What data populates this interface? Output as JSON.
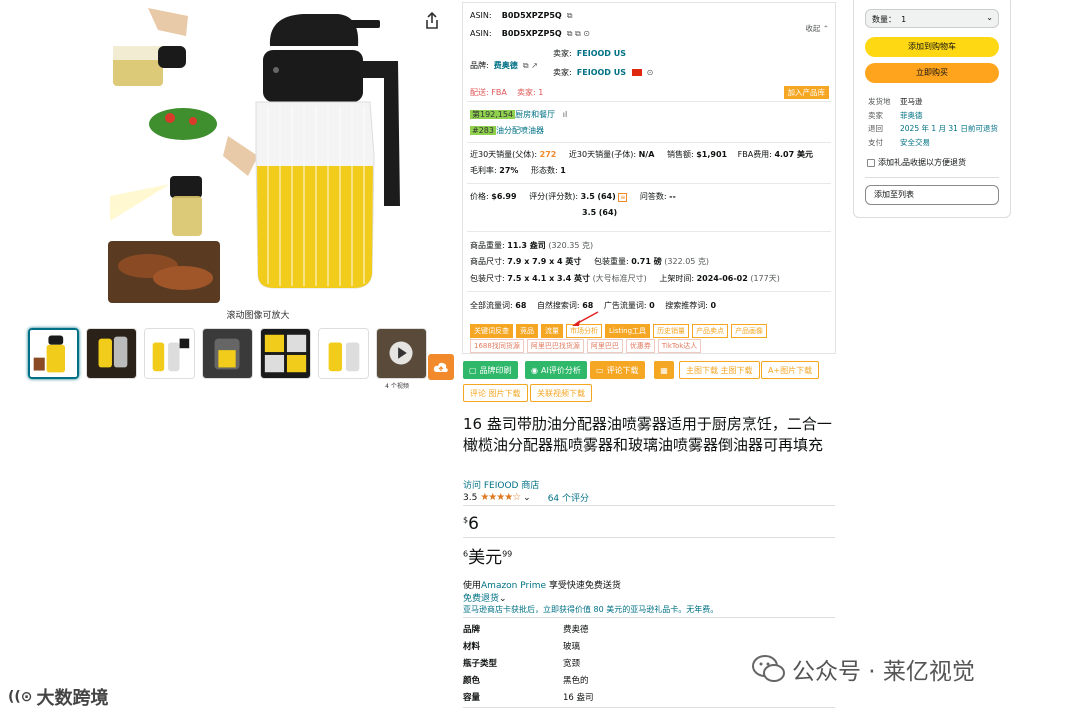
{
  "gallery": {
    "zoom_hint": "滚动图像可放大",
    "video_count": "4 个视频",
    "icons": [
      "share-icon",
      "upload-cloud-icon",
      "play-icon"
    ]
  },
  "plugin": {
    "asin_label_1": "ASIN:",
    "asin_value_1": "B0D5XPZP5Q",
    "collapse": "收起 ⌃",
    "asin_label_2": "ASIN:",
    "asin_value_2": "B0D5XPZP5Q",
    "brand_label": "品牌:",
    "brand_value": "费奥德",
    "seller_label_1": "卖家:",
    "seller_value_1": "FEIOOD US",
    "seller_label_2": "卖家:",
    "seller_value_2": "FEIOOD US",
    "fulfill": "配送: FBA",
    "sellers_count": "卖家: 1",
    "add_library": "加入产品库",
    "rank1_num": "第192,154",
    "rank1_cat": "厨房和餐厅",
    "rank2_num": "#283",
    "rank2_cat": "油分配喷油器",
    "sales_parent_label": "近30天销量(父体):",
    "sales_parent_value": "272",
    "sales_child_label": "近30天销量(子体):",
    "sales_child_value": "N/A",
    "revenue_label": "销售额:",
    "revenue_value": "$1,901",
    "fba_label": "FBA费用:",
    "fba_value": "4.07 美元",
    "margin_label": "毛利率:",
    "margin_value": "27%",
    "variants_label": "形态数:",
    "variants_value": "1",
    "price_label": "价格:",
    "price_value": "$6.99",
    "rating_label": "评分(评分数):",
    "rating_value_1": "3.5",
    "rating_count_1": "(64)",
    "rating_value_2": "3.5",
    "rating_count_2": "(64)",
    "qa_label": "问答数:",
    "qa_value": "--",
    "weight_label": "商品重量:",
    "weight_value": "11.3 盎司",
    "weight_alt": "(320.35 克)",
    "size_label": "商品尺寸:",
    "size_value": "7.9 x 7.9 x 4 英寸",
    "pkg_weight_label": "包装重量:",
    "pkg_weight_value": "0.71 磅",
    "pkg_weight_alt": "(322.05 克)",
    "pkg_size_label": "包装尺寸:",
    "pkg_size_value": "7.5 x 4.1 x 3.4 英寸",
    "pkg_size_alt": "(大号标准尺寸)",
    "listed_label": "上架时间:",
    "listed_value": "2024-06-02",
    "listed_alt": "(177天)",
    "traffic_all_label": "全部流量词:",
    "traffic_all_value": "68",
    "traffic_natural_label": "自然搜索词:",
    "traffic_natural_value": "68",
    "traffic_ad_label": "广告流量词:",
    "traffic_ad_value": "0",
    "traffic_rec_label": "搜索推荐词:",
    "traffic_rec_value": "0",
    "chips_row1": [
      "关键词反查",
      "竞品",
      "流量",
      "市场分析",
      "Listing工具",
      "历史销量",
      "产品卖点",
      "产品画像"
    ],
    "chips_row2": [
      "1688找同货源",
      "阿里巴巴找货源",
      "阿里巴巴",
      "优惠券",
      "TikTok达人"
    ]
  },
  "toolbar": {
    "brand_record": "品牌印刷",
    "ai_review": "AI评价分析",
    "review_download": "评论下载",
    "main_img_download": "主图下载 主图下载",
    "aplus_download": "A+图片下载",
    "review_img_download": "评论 图片下载",
    "related_video_download": "关联视频下载"
  },
  "product": {
    "title": "16 盎司带肋油分配器油喷雾器适用于厨房烹饪，二合一橄榄油分配器瓶喷雾器和玻璃油喷雾器倒油器可再填充",
    "store_link": "访问 FEIOOD 商店",
    "rating": "3.5",
    "rating_count": "64 个评分",
    "price_symbol": "$",
    "price_whole": "6",
    "price2_sup": "6",
    "price2_text": "美元",
    "price2_cents": "99",
    "prime_prefix": "使用",
    "prime_link": "Amazon Prime",
    "prime_suffix": " 享受快速免费送货",
    "free_returns": "免费退货",
    "gift_promo": "亚马逊商店卡获批后，立即获得价值 80 美元的亚马逊礼品卡。无年费。",
    "specs": [
      {
        "k": "品牌",
        "v": "费奥德"
      },
      {
        "k": "材料",
        "v": "玻璃"
      },
      {
        "k": "瓶子类型",
        "v": "宽颈"
      },
      {
        "k": "颜色",
        "v": "黑色的"
      },
      {
        "k": "容量",
        "v": "16 盎司"
      }
    ]
  },
  "buybox": {
    "qty_label": "数量：",
    "qty_value": "1",
    "add_to_cart": "添加到购物车",
    "buy_now": "立即购买",
    "ship_from_label": "发货地",
    "ship_from_value": "亚马逊",
    "seller_label": "卖家",
    "seller_value": "菲奥德",
    "return_label": "退回",
    "return_value": "2025 年 1 月 31 日前可退货",
    "payment_label": "支付",
    "payment_value": "安全交易",
    "gift_receipt": "添加礼品收据以方便退货",
    "add_to_list": "添加至列表"
  },
  "watermarks": {
    "right": "公众号 · 莱亿视觉",
    "left": "大数跨境"
  }
}
